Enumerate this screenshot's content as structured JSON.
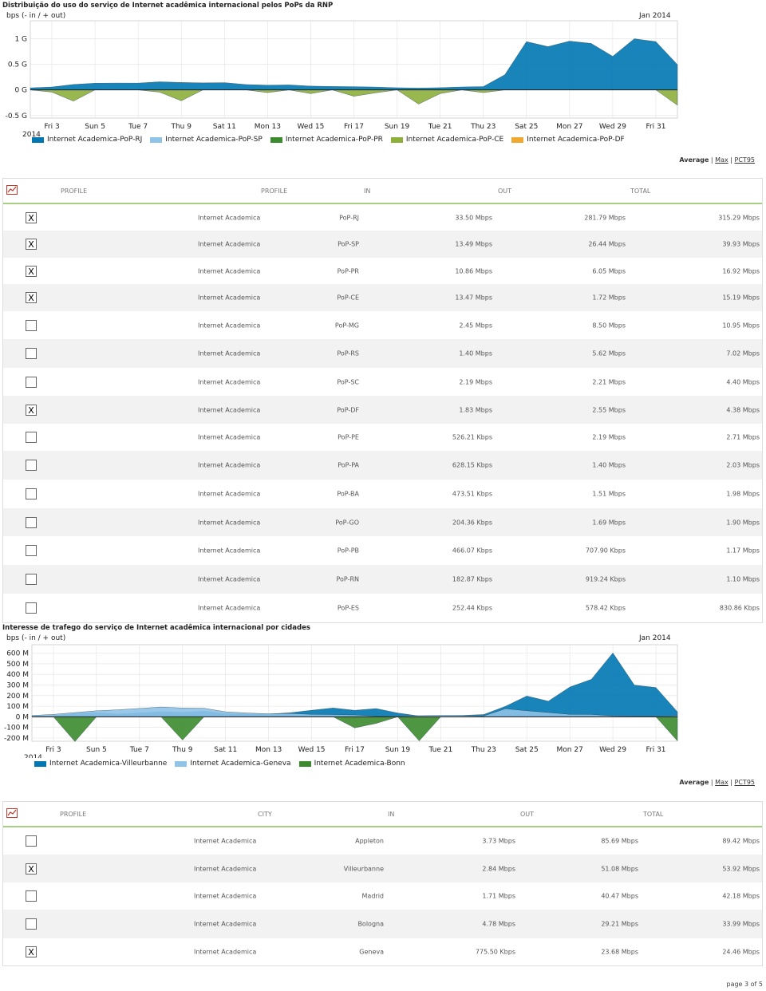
{
  "charts": [
    {
      "title": "Distribuição do uso do serviço de Internet acadêmica internacional pelos PoPs da RNP",
      "ylabel": "bps (- in / + out)",
      "period": "Jan 2014",
      "year_label": "2014",
      "x_ticks": [
        "Fri 3",
        "Sun 5",
        "Tue 7",
        "Thu 9",
        "Sat 11",
        "Mon 13",
        "Wed 15",
        "Fri 17",
        "Sun 19",
        "Tue 21",
        "Thu 23",
        "Sat 25",
        "Mon 27",
        "Wed 29",
        "Fri 31"
      ],
      "y_ticks": [
        "1 G",
        "0.5 G",
        "0 G",
        "-0.5 G"
      ],
      "legend": [
        {
          "name": "Internet Academica-PoP-RJ",
          "color": "#0077b3"
        },
        {
          "name": "Internet Academica-PoP-SP",
          "color": "#8fc3e8"
        },
        {
          "name": "Internet Academica-PoP-PR",
          "color": "#3d8b2f"
        },
        {
          "name": "Internet Academica-PoP-CE",
          "color": "#8db03b"
        },
        {
          "name": "Internet Academica-PoP-DF",
          "color": "#f0a830"
        }
      ]
    },
    {
      "title": "Interesse de trafego do serviço de Internet acadêmica internacional por cidades",
      "ylabel": "bps (- in / + out)",
      "period": "Jan 2014",
      "year_label": "2014",
      "x_ticks": [
        "Fri 3",
        "Sun 5",
        "Tue 7",
        "Thu 9",
        "Sat 11",
        "Mon 13",
        "Wed 15",
        "Fri 17",
        "Sun 19",
        "Tue 21",
        "Thu 23",
        "Sat 25",
        "Mon 27",
        "Wed 29",
        "Fri 31"
      ],
      "y_ticks": [
        "600 M",
        "500 M",
        "400 M",
        "300 M",
        "200 M",
        "100 M",
        "0 M",
        "-100 M",
        "-200 M"
      ],
      "legend": [
        {
          "name": "Internet Academica-Villeurbanne",
          "color": "#0077b3"
        },
        {
          "name": "Internet Academica-Geneva",
          "color": "#8fc3e8"
        },
        {
          "name": "Internet Academica-Bonn",
          "color": "#3d8b2f"
        }
      ]
    }
  ],
  "controls": {
    "average": "Average",
    "sep": "|",
    "max": "Max",
    "pct": "PCT95"
  },
  "table1": {
    "headers": [
      "PROFILE",
      "PROFILE",
      "IN",
      "OUT",
      "TOTAL"
    ],
    "rows": [
      {
        "checked": "X",
        "profile": "Internet Academica",
        "pop": "PoP-RJ",
        "in": "33.50 Mbps",
        "out": "281.79 Mbps",
        "total": "315.29 Mbps"
      },
      {
        "checked": "X",
        "profile": "Internet Academica",
        "pop": "PoP-SP",
        "in": "13.49 Mbps",
        "out": "26.44 Mbps",
        "total": "39.93 Mbps"
      },
      {
        "checked": "X",
        "profile": "Internet Academica",
        "pop": "PoP-PR",
        "in": "10.86 Mbps",
        "out": "6.05 Mbps",
        "total": "16.92 Mbps"
      },
      {
        "checked": "X",
        "profile": "Internet Academica",
        "pop": "PoP-CE",
        "in": "13.47 Mbps",
        "out": "1.72 Mbps",
        "total": "15.19 Mbps"
      },
      {
        "checked": "",
        "profile": "Internet Academica",
        "pop": "PoP-MG",
        "in": "2.45 Mbps",
        "out": "8.50 Mbps",
        "total": "10.95 Mbps"
      },
      {
        "checked": "",
        "profile": "Internet Academica",
        "pop": "PoP-RS",
        "in": "1.40 Mbps",
        "out": "5.62 Mbps",
        "total": "7.02 Mbps"
      },
      {
        "checked": "",
        "profile": "Internet Academica",
        "pop": "PoP-SC",
        "in": "2.19 Mbps",
        "out": "2.21 Mbps",
        "total": "4.40 Mbps"
      },
      {
        "checked": "X",
        "profile": "Internet Academica",
        "pop": "PoP-DF",
        "in": "1.83 Mbps",
        "out": "2.55 Mbps",
        "total": "4.38 Mbps"
      },
      {
        "checked": "",
        "profile": "Internet Academica",
        "pop": "PoP-PE",
        "in": "526.21 Kbps",
        "out": "2.19 Mbps",
        "total": "2.71 Mbps"
      },
      {
        "checked": "",
        "profile": "Internet Academica",
        "pop": "PoP-PA",
        "in": "628.15 Kbps",
        "out": "1.40 Mbps",
        "total": "2.03 Mbps"
      },
      {
        "checked": "",
        "profile": "Internet Academica",
        "pop": "PoP-BA",
        "in": "473.51 Kbps",
        "out": "1.51 Mbps",
        "total": "1.98 Mbps"
      },
      {
        "checked": "",
        "profile": "Internet Academica",
        "pop": "PoP-GO",
        "in": "204.36 Kbps",
        "out": "1.69 Mbps",
        "total": "1.90 Mbps"
      },
      {
        "checked": "",
        "profile": "Internet Academica",
        "pop": "PoP-PB",
        "in": "466.07 Kbps",
        "out": "707.90 Kbps",
        "total": "1.17 Mbps"
      },
      {
        "checked": "",
        "profile": "Internet Academica",
        "pop": "PoP-RN",
        "in": "182.87 Kbps",
        "out": "919.24 Kbps",
        "total": "1.10 Mbps"
      },
      {
        "checked": "",
        "profile": "Internet Academica",
        "pop": "PoP-ES",
        "in": "252.44 Kbps",
        "out": "578.42 Kbps",
        "total": "830.86 Kbps"
      }
    ]
  },
  "table2": {
    "headers": [
      "PROFILE",
      "CITY",
      "IN",
      "OUT",
      "TOTAL"
    ],
    "rows": [
      {
        "checked": "",
        "profile": "Internet Academica",
        "city": "Appleton",
        "in": "3.73 Mbps",
        "out": "85.69 Mbps",
        "total": "89.42 Mbps"
      },
      {
        "checked": "X",
        "profile": "Internet Academica",
        "city": "Villeurbanne",
        "in": "2.84 Mbps",
        "out": "51.08 Mbps",
        "total": "53.92 Mbps"
      },
      {
        "checked": "",
        "profile": "Internet Academica",
        "city": "Madrid",
        "in": "1.71 Mbps",
        "out": "40.47 Mbps",
        "total": "42.18 Mbps"
      },
      {
        "checked": "",
        "profile": "Internet Academica",
        "city": "Bologna",
        "in": "4.78 Mbps",
        "out": "29.21 Mbps",
        "total": "33.99 Mbps"
      },
      {
        "checked": "X",
        "profile": "Internet Academica",
        "city": "Geneva",
        "in": "775.50 Kbps",
        "out": "23.68 Mbps",
        "total": "24.46 Mbps"
      }
    ]
  },
  "footer": "page 3 of 5",
  "chart_data": [
    {
      "type": "area",
      "title": "Distribuição do uso do serviço de Internet acadêmica internacional pelos PoPs da RNP",
      "ylabel": "bps (- in / + out)",
      "ylim": [
        -0.55,
        1.35
      ],
      "x": [
        2,
        3,
        4,
        5,
        6,
        7,
        8,
        9,
        10,
        11,
        12,
        13,
        14,
        15,
        16,
        17,
        18,
        19,
        20,
        21,
        22,
        23,
        24,
        25,
        26,
        27,
        28,
        29,
        30,
        31,
        32
      ],
      "series": [
        {
          "name": "Internet Academica-PoP-RJ",
          "values": [
            0.04,
            0.05,
            0.1,
            0.13,
            0.14,
            0.14,
            0.16,
            0.14,
            0.13,
            0.14,
            0.11,
            0.1,
            0.1,
            0.07,
            0.06,
            0.06,
            0.06,
            0.05,
            0.04,
            0.04,
            0.05,
            0.06,
            0.3,
            0.95,
            0.85,
            0.95,
            0.9,
            0.65,
            1.0,
            0.95,
            0.5
          ]
        },
        {
          "name": "Internet Academica-PoP-CE",
          "values": [
            0,
            -0.05,
            -0.22,
            0,
            0,
            0,
            -0.05,
            -0.22,
            0,
            0,
            0,
            -0.05,
            0,
            -0.08,
            0,
            -0.12,
            -0.05,
            0,
            -0.28,
            -0.08,
            0,
            -0.05,
            0,
            0,
            0,
            0,
            0,
            0,
            0,
            0,
            -0.3
          ]
        }
      ]
    },
    {
      "type": "area",
      "title": "Interesse de trafego do serviço de Internet acadêmica internacional por cidades",
      "ylabel": "bps (- in / + out)",
      "ylim": [
        -230,
        680
      ],
      "x": [
        2,
        3,
        4,
        5,
        6,
        7,
        8,
        9,
        10,
        11,
        12,
        13,
        14,
        15,
        16,
        17,
        18,
        19,
        20,
        21,
        22,
        23,
        24,
        25,
        26,
        27,
        28,
        29,
        30,
        31,
        32
      ],
      "series": [
        {
          "name": "Internet Academica-Villeurbanne",
          "values": [
            5,
            10,
            30,
            40,
            30,
            40,
            50,
            40,
            50,
            30,
            30,
            30,
            40,
            60,
            80,
            60,
            80,
            40,
            10,
            10,
            10,
            20,
            100,
            200,
            150,
            280,
            350,
            600,
            300,
            280,
            50
          ]
        },
        {
          "name": "Internet Academica-Geneva",
          "values": [
            10,
            20,
            40,
            60,
            70,
            80,
            90,
            80,
            80,
            50,
            40,
            30,
            30,
            20,
            20,
            20,
            10,
            10,
            10,
            10,
            10,
            10,
            80,
            60,
            40,
            20,
            20,
            10,
            10,
            10,
            10
          ]
        },
        {
          "name": "Internet Academica-Bonn",
          "values": [
            0,
            0,
            -230,
            0,
            0,
            0,
            0,
            -220,
            0,
            0,
            0,
            0,
            0,
            0,
            0,
            -100,
            -60,
            0,
            -230,
            0,
            0,
            0,
            0,
            0,
            0,
            0,
            0,
            0,
            0,
            0,
            -230
          ]
        }
      ]
    }
  ]
}
